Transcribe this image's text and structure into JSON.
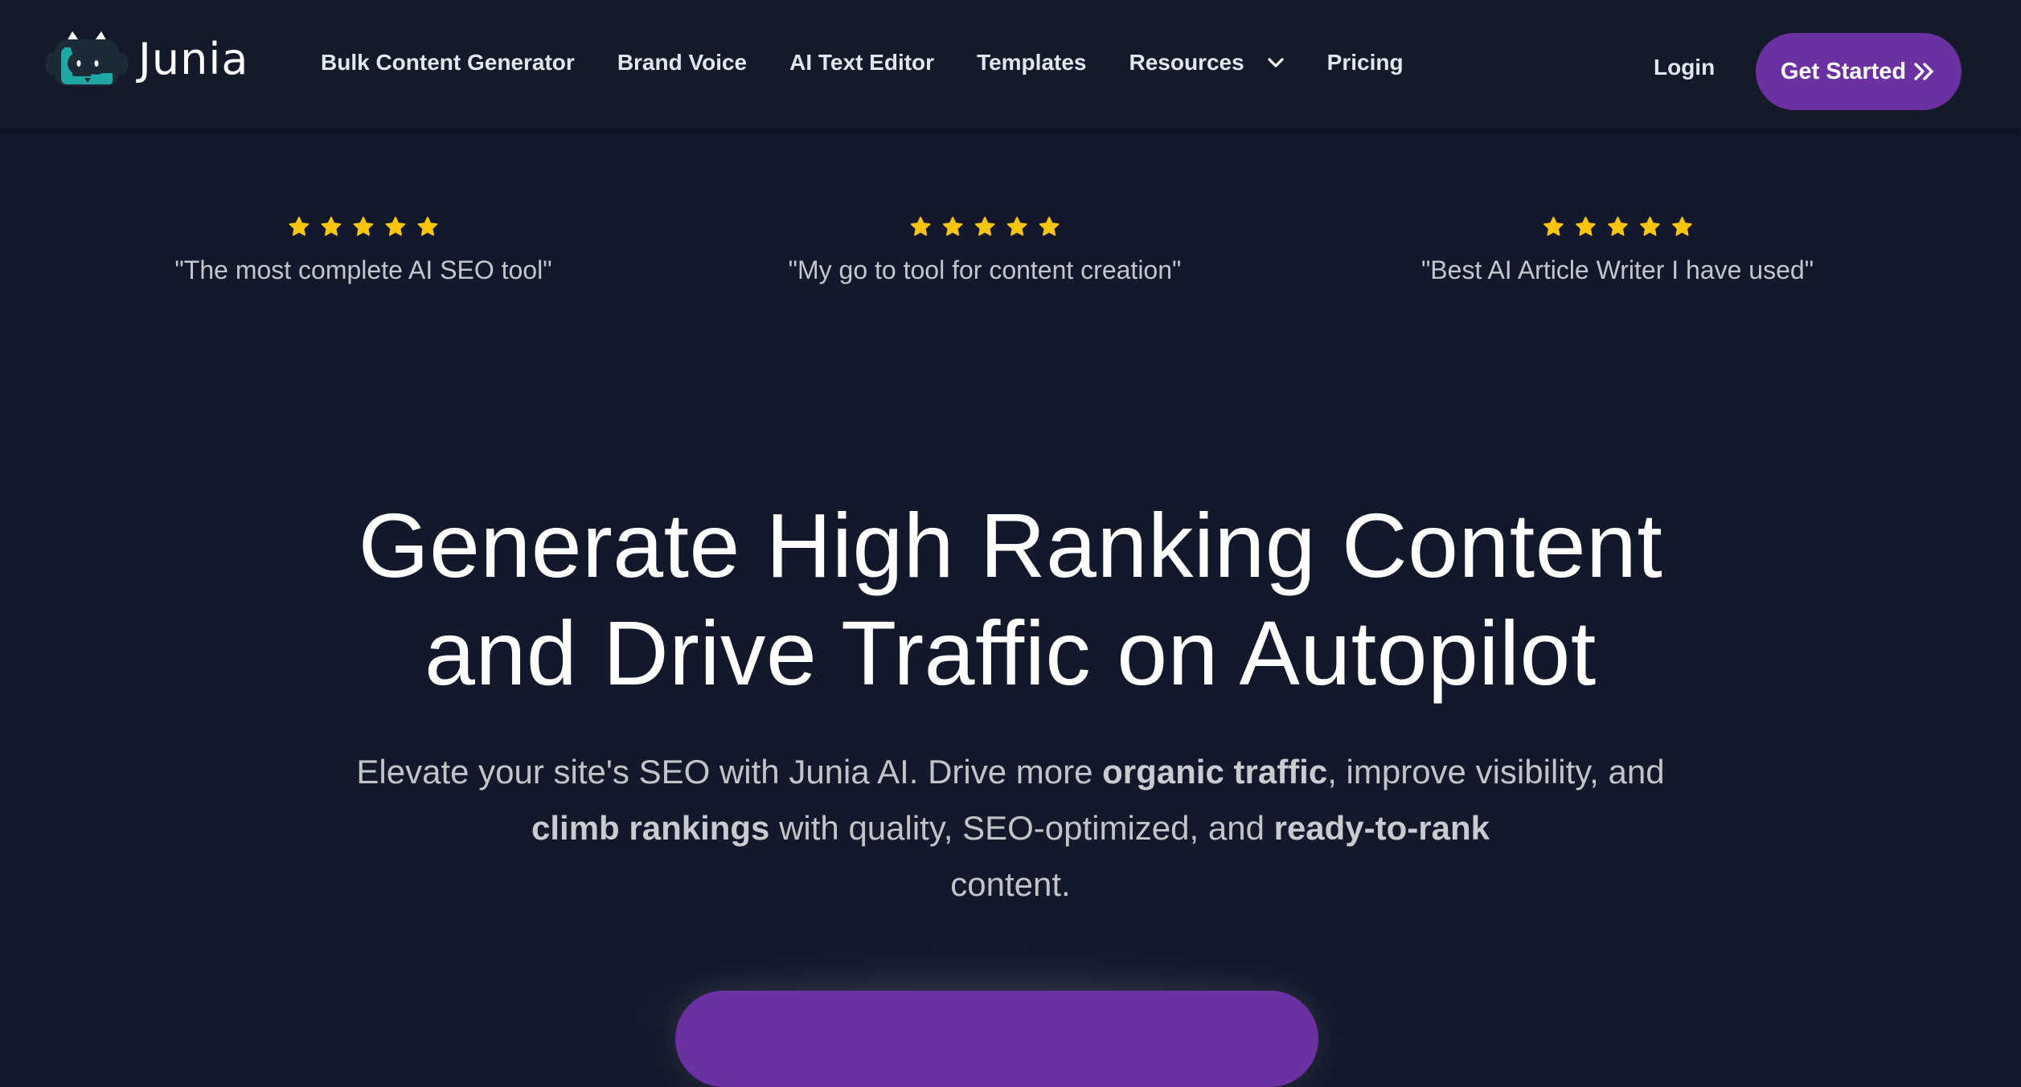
{
  "brand": {
    "name": "Junia",
    "logo_icon": "robot-cat-logo-icon",
    "accent_color": "#6c31a0",
    "logo_color": "#1fa9a6"
  },
  "nav": {
    "items": [
      {
        "label": "Bulk Content Generator"
      },
      {
        "label": "Brand Voice"
      },
      {
        "label": "AI Text Editor"
      },
      {
        "label": "Templates"
      },
      {
        "label": "Resources",
        "icon": "chevron-down-icon"
      },
      {
        "label": "Pricing"
      }
    ],
    "login_label": "Login",
    "cta_label": "Get Started",
    "cta_icon": "double-chevron-right-icon"
  },
  "reviews": [
    {
      "rating": 5,
      "quote": "\"The most complete AI SEO tool\""
    },
    {
      "rating": 5,
      "quote": "\"My go to tool for content creation\""
    },
    {
      "rating": 5,
      "quote": "\"Best AI Article Writer I have used\""
    }
  ],
  "star_color": "#f8c40c",
  "hero": {
    "title_line1": "Generate High Ranking Content",
    "title_line2": "and Drive Traffic on Autopilot",
    "subtitle": {
      "p1": "Elevate your site's SEO with Junia AI. Drive more ",
      "b1": "organic traffic",
      "p2": ", improve visibility, and ",
      "b2": "climb rankings",
      "p3": " with quality, SEO-optimized, and ",
      "b3": "ready-to-rank",
      "p4": " content."
    }
  }
}
